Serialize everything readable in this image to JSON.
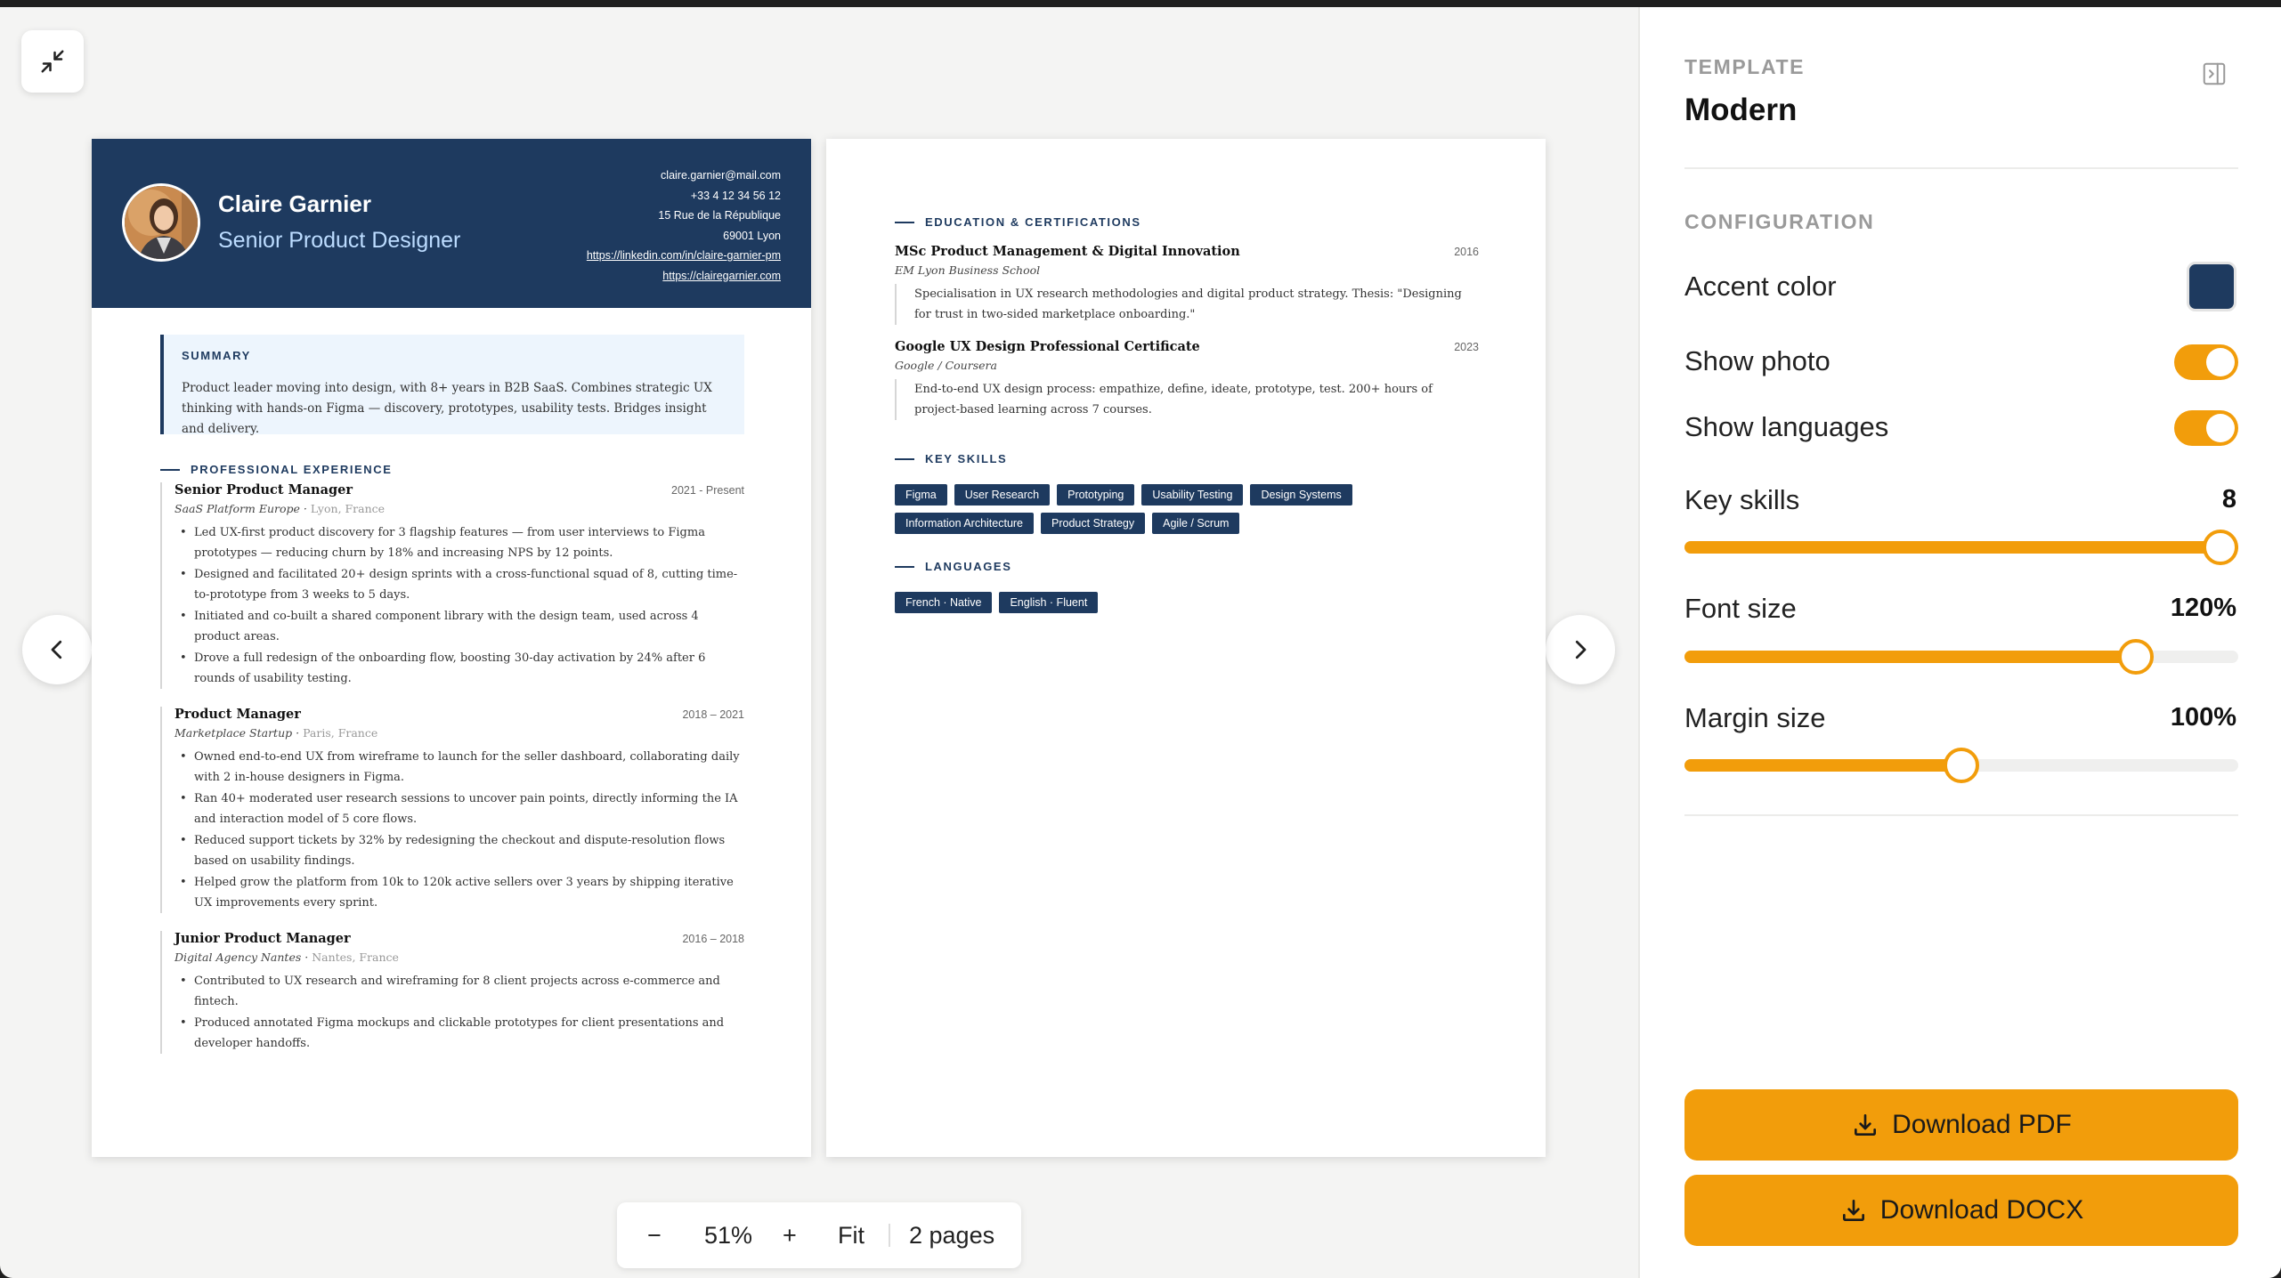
{
  "resume": {
    "name": "Claire Garnier",
    "title": "Senior Product Designer",
    "contact": {
      "email": "claire.garnier@mail.com",
      "phone": "+33 4 12 34 56 12",
      "street": "15 Rue de la République",
      "city": "69001 Lyon",
      "linkedin": "https://linkedin.com/in/claire-garnier-pm",
      "website": "https://clairegarnier.com"
    },
    "summary": {
      "heading": "SUMMARY",
      "text": "Product leader moving into design, with 8+ years in B2B SaaS. Combines strategic UX thinking with hands-on Figma — discovery, prototypes, usability tests. Bridges insight and delivery."
    },
    "experience": {
      "heading": "PROFESSIONAL EXPERIENCE",
      "items": [
        {
          "role": "Senior Product Manager",
          "dates": "2021 - Present",
          "company": "SaaS Platform Europe",
          "location": "Lyon, France",
          "bullets": [
            "Led UX-first product discovery for 3 flagship features — from user interviews to Figma prototypes — reducing churn by 18% and increasing NPS by 12 points.",
            "Designed and facilitated 20+ design sprints with a cross-functional squad of 8, cutting time-to-prototype from 3 weeks to 5 days.",
            "Initiated and co-built a shared component library with the design team, used across 4 product areas.",
            "Drove a full redesign of the onboarding flow, boosting 30-day activation by 24% after 6 rounds of usability testing."
          ]
        },
        {
          "role": "Product Manager",
          "dates": "2018 – 2021",
          "company": "Marketplace Startup",
          "location": "Paris, France",
          "bullets": [
            "Owned end-to-end UX from wireframe to launch for the seller dashboard, collaborating daily with 2 in-house designers in Figma.",
            "Ran 40+ moderated user research sessions to uncover pain points, directly informing the IA and interaction model of 5 core flows.",
            "Reduced support tickets by 32% by redesigning the checkout and dispute-resolution flows based on usability findings.",
            "Helped grow the platform from 10k to 120k active sellers over 3 years by shipping iterative UX improvements every sprint."
          ]
        },
        {
          "role": "Junior Product Manager",
          "dates": "2016 – 2018",
          "company": "Digital Agency Nantes",
          "location": "Nantes, France",
          "bullets": [
            "Contributed to UX research and wireframing for 8 client projects across e-commerce and fintech.",
            "Produced annotated Figma mockups and clickable prototypes for client presentations and developer handoffs."
          ]
        }
      ]
    },
    "education": {
      "heading": "EDUCATION & CERTIFICATIONS",
      "items": [
        {
          "degree": "MSc Product Management & Digital Innovation",
          "year": "2016",
          "school": "EM Lyon Business School",
          "desc": "Specialisation in UX research methodologies and digital product strategy. Thesis: \"Designing for trust in two-sided marketplace onboarding.\""
        },
        {
          "degree": "Google UX Design Professional Certificate",
          "year": "2023",
          "school": "Google / Coursera",
          "desc": "End-to-end UX design process: empathize, define, ideate, prototype, test. 200+ hours of project-based learning across 7 courses."
        }
      ]
    },
    "skills": {
      "heading": "KEY SKILLS",
      "items": [
        "Figma",
        "User Research",
        "Prototyping",
        "Usability Testing",
        "Design Systems",
        "Information Architecture",
        "Product Strategy",
        "Agile / Scrum"
      ]
    },
    "languages": {
      "heading": "LANGUAGES",
      "items": [
        "French · Native",
        "English · Fluent"
      ]
    }
  },
  "zoom": {
    "minus": "−",
    "value": "51%",
    "plus": "+",
    "fit": "Fit",
    "pages": "2 pages"
  },
  "sidebar": {
    "template_label": "TEMPLATE",
    "template_name": "Modern",
    "config_label": "CONFIGURATION",
    "accent_color_label": "Accent color",
    "accent_color": "#1e3a5f",
    "show_photo_label": "Show photo",
    "show_photo": true,
    "show_languages_label": "Show languages",
    "show_languages": true,
    "key_skills_label": "Key skills",
    "key_skills_value": "8",
    "key_skills_fraction": 1.0,
    "font_size_label": "Font size",
    "font_size_value": "120%",
    "font_size_fraction": 0.815,
    "margin_size_label": "Margin size",
    "margin_size_value": "100%",
    "margin_size_fraction": 0.5,
    "download_pdf": "Download PDF",
    "download_docx": "Download DOCX"
  },
  "colors": {
    "accent": "#1e3a5f",
    "brand": "#f29d0b"
  }
}
